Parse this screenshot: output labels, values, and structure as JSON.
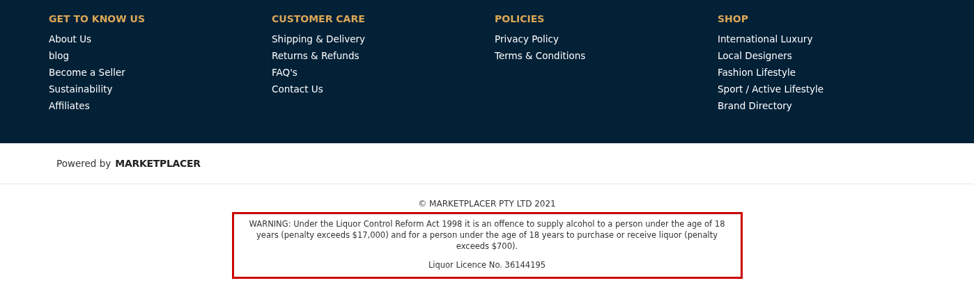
{
  "footer_columns": [
    {
      "heading": "GET TO KNOW US",
      "links": [
        "About Us",
        "blog",
        "Become a Seller",
        "Sustainability",
        "Affiliates"
      ]
    },
    {
      "heading": "CUSTOMER CARE",
      "links": [
        "Shipping & Delivery",
        "Returns & Refunds",
        "FAQ's",
        "Contact Us"
      ]
    },
    {
      "heading": "POLICIES",
      "links": [
        "Privacy Policy",
        "Terms & Conditions"
      ]
    },
    {
      "heading": "SHOP",
      "links": [
        "International Luxury",
        "Local Designers",
        "Fashion Lifestyle",
        "Sport / Active Lifestyle",
        "Brand Directory"
      ]
    }
  ],
  "powered_by": {
    "label": "Powered by",
    "logo": "MARKETPLACER"
  },
  "copyright": "© MARKETPLACER PTY LTD 2021",
  "warning": {
    "text": "WARNING: Under the Liquor Control Reform Act 1998 it is an offence to supply alcohol to a person under the age of 18 years (penalty exceeds $17,000) and for a person under the age of 18 years to purchase or receive liquor (penalty exceeds $700).",
    "licence": "Liquor Licence No. 36144195"
  }
}
